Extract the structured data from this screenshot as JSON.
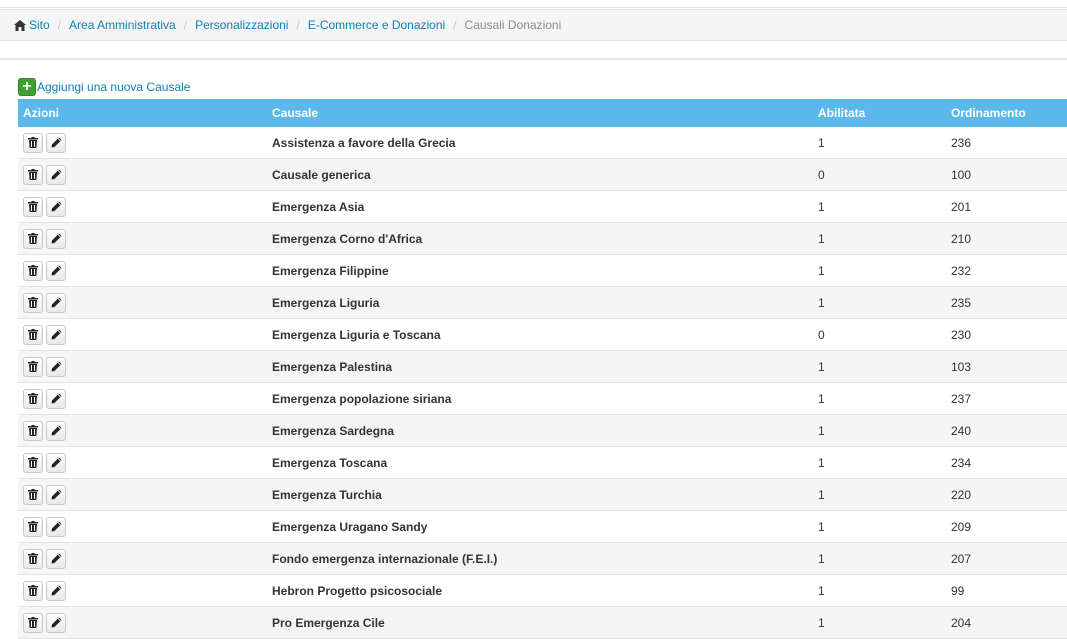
{
  "breadcrumb": {
    "items": [
      "Sito",
      "Area Amministrativa",
      "Personalizzazioni",
      "E-Commerce e Donazioni"
    ],
    "current": "Causali Donazioni",
    "separator": "/"
  },
  "toolbar": {
    "add_label": "Aggiungi una nuova Causale"
  },
  "table": {
    "headers": {
      "actions": "Azioni",
      "causale": "Causale",
      "abilitata": "Abilitata",
      "ordinamento": "Ordinamento"
    },
    "rows": [
      {
        "causale": "Assistenza a favore della Grecia",
        "abilitata": "1",
        "ordinamento": "236"
      },
      {
        "causale": "Causale generica",
        "abilitata": "0",
        "ordinamento": "100"
      },
      {
        "causale": "Emergenza Asia",
        "abilitata": "1",
        "ordinamento": "201"
      },
      {
        "causale": "Emergenza Corno d'Africa",
        "abilitata": "1",
        "ordinamento": "210"
      },
      {
        "causale": "Emergenza Filippine",
        "abilitata": "1",
        "ordinamento": "232"
      },
      {
        "causale": "Emergenza Liguria",
        "abilitata": "1",
        "ordinamento": "235"
      },
      {
        "causale": "Emergenza Liguria e Toscana",
        "abilitata": "0",
        "ordinamento": "230"
      },
      {
        "causale": "Emergenza Palestina",
        "abilitata": "1",
        "ordinamento": "103"
      },
      {
        "causale": "Emergenza popolazione siriana",
        "abilitata": "1",
        "ordinamento": "237"
      },
      {
        "causale": "Emergenza Sardegna",
        "abilitata": "1",
        "ordinamento": "240"
      },
      {
        "causale": "Emergenza Toscana",
        "abilitata": "1",
        "ordinamento": "234"
      },
      {
        "causale": "Emergenza Turchia",
        "abilitata": "1",
        "ordinamento": "220"
      },
      {
        "causale": "Emergenza Uragano Sandy",
        "abilitata": "1",
        "ordinamento": "209"
      },
      {
        "causale": "Fondo emergenza internazionale (F.E.I.)",
        "abilitata": "1",
        "ordinamento": "207"
      },
      {
        "causale": "Hebron Progetto psicosociale",
        "abilitata": "1",
        "ordinamento": "99"
      },
      {
        "causale": "Pro Emergenza Cile",
        "abilitata": "1",
        "ordinamento": "204"
      }
    ]
  },
  "icons": {
    "home": "home-icon",
    "add": "plus-icon",
    "delete": "trash-icon",
    "edit": "pencil-icon"
  },
  "colors": {
    "header_bg": "#5bb8ea",
    "link": "#0e7fb5",
    "add_icon": "#3ea12e"
  }
}
